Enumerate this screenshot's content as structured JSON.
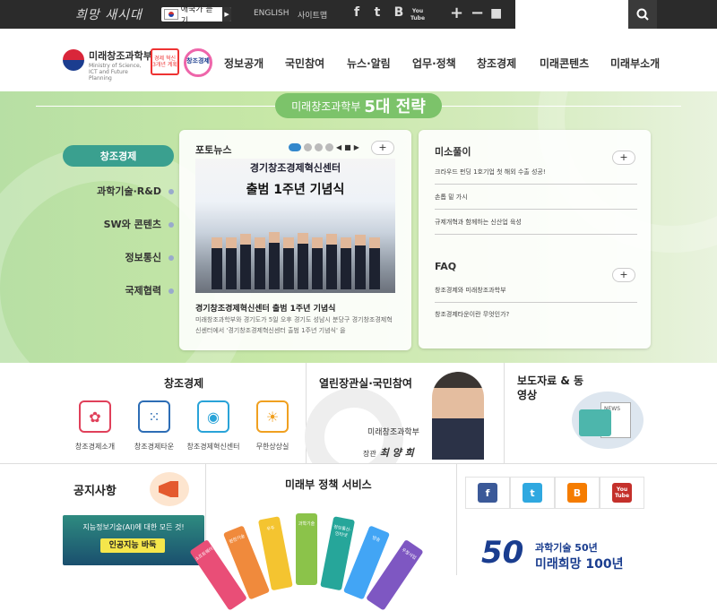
{
  "topbar": {
    "slogan": "희망 새시대",
    "anthem_label": "애국가 듣기",
    "english": "ENGLISH",
    "sitemap": "사이트맵",
    "sns": [
      "f",
      "t",
      "B",
      "You Tube"
    ],
    "zoom_in": "+",
    "zoom_out": "−",
    "reset": "■"
  },
  "header": {
    "ministry": "미래창조과학부",
    "ministry_en": "Ministry of Science, ICT and Future Planning",
    "badge1": "경제 혁신 3개년 계획",
    "badge2": "창조경제",
    "nav": [
      "정보공개",
      "국민참여",
      "뉴스·알림",
      "업무·정책",
      "창조경제",
      "미래콘텐츠",
      "미래부소개"
    ]
  },
  "hero": {
    "title_prefix": "미래창조과학부",
    "title_main": "5대 전략",
    "left_menu": [
      "창조경제",
      "과학기술·R&D",
      "SW와 콘텐츠",
      "정보통신",
      "국제협력"
    ],
    "photo_news": {
      "title": "포토뉴스",
      "banner_line1": "경기창조경제혁신센터",
      "banner_line2": "출범 1주년 기념식",
      "caption": "경기창조경제혁신센터 출범 1주년 기념식",
      "desc": "미래창조과학부와 경기도가 5일 오후 경기도 성남시 분당구 경기창조경제혁신센터에서 '경기창조경제혁신센터 출범 1주년 기념식' 을"
    },
    "misopuri": {
      "title": "미소풀이",
      "items": [
        "크라우드 펀딩 1호기업 첫 해외 수출 성공!",
        "손톱 밑 가시",
        "규제개혁과 함께하는 신산업 육성"
      ]
    },
    "faq": {
      "title": "FAQ",
      "items": [
        "창조경제와 미래창조과학부",
        "창조경제타운이란 무엇인가?"
      ]
    },
    "plus": "+"
  },
  "creative": {
    "title": "창조경제",
    "services": [
      {
        "label": "창조경제소개",
        "icon": "creative-economy-icon",
        "color": "#e0405a"
      },
      {
        "label": "창조경제타운",
        "icon": "dots-grid-icon",
        "color": "#2d6db5"
      },
      {
        "label": "창조경제혁신센터",
        "icon": "broadcast-icon",
        "color": "#29a3d8"
      },
      {
        "label": "무한상상실",
        "icon": "lightbulb-icon",
        "color": "#f0a020"
      }
    ]
  },
  "minister": {
    "title": "열린장관실·국민참여",
    "line1": "미래창조과학부",
    "line2_label": "장관",
    "line2_sign": "최 양 희"
  },
  "press": {
    "title": "보도자료 & 동영상",
    "icon_text": "NEWS"
  },
  "notice": {
    "title": "공지사항",
    "ai_text": "지능정보기술(AI)에 대한 모든 것!",
    "ai_button": "인공지능 바둑"
  },
  "policy": {
    "title": "미래부 정책 서비스",
    "fans": [
      {
        "label": "소프트웨어",
        "color": "#e94e77"
      },
      {
        "label": "원천기술",
        "color": "#f08a3c"
      },
      {
        "label": "우주",
        "color": "#f4c430"
      },
      {
        "label": "과학기술",
        "color": "#8bc34a"
      },
      {
        "label": "정보통신·인터넷",
        "color": "#26a69a"
      },
      {
        "label": "방송",
        "color": "#42a5f5"
      },
      {
        "label": "우정사업",
        "color": "#7e57c2"
      }
    ]
  },
  "social": [
    {
      "name": "facebook",
      "glyph": "f",
      "color": "#3b5998"
    },
    {
      "name": "twitter",
      "glyph": "t",
      "color": "#2fa8e0"
    },
    {
      "name": "blog",
      "glyph": "B",
      "color": "#f57c00"
    },
    {
      "name": "youtube",
      "glyph": "You Tube",
      "color": "#c4302b"
    }
  ],
  "anniversary": {
    "number": "50",
    "line1": "과학기술 50년",
    "line2": "미래희망 100년"
  }
}
